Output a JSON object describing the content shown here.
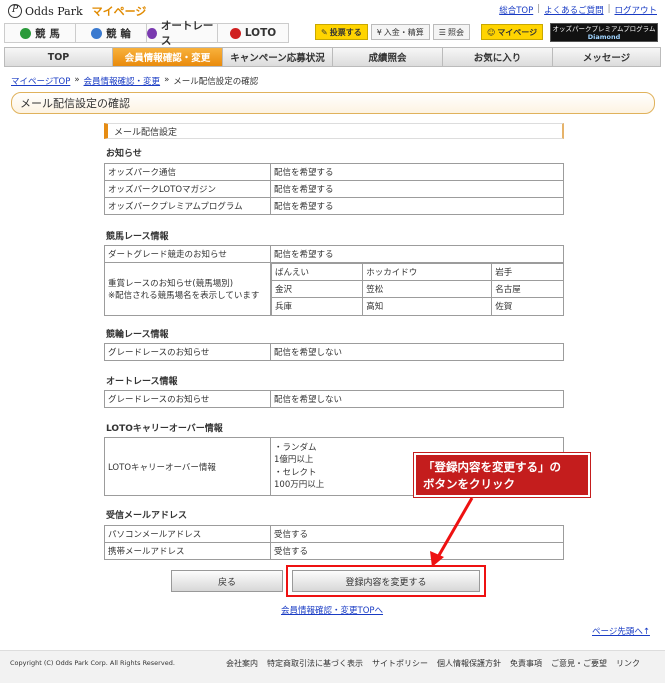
{
  "header": {
    "logo_text": "Odds Park",
    "logo_mypage": "マイページ",
    "top_links": [
      "総合TOP",
      "よくあるご質問",
      "ログアウト"
    ],
    "games": [
      {
        "label": "競 馬",
        "color": "#2a9a3a"
      },
      {
        "label": "競 輪",
        "color": "#3a7ad0"
      },
      {
        "label": "オートレース",
        "color": "#7a3ab0"
      },
      {
        "label": "LOTO",
        "color": "#d02020"
      }
    ],
    "actions": [
      "投票する",
      "入金・精算",
      "照会",
      "マイページ"
    ],
    "premium_line1": "オッズパークプレミアムプログラム",
    "premium_line2": "Diamond"
  },
  "nav": {
    "items": [
      "TOP",
      "会員情報確認・変更",
      "キャンペーン応募状況",
      "成績照会",
      "お気に入り",
      "メッセージ"
    ],
    "active": 1
  },
  "breadcrumb": {
    "items": [
      "マイページTOP",
      "会員情報確認・変更",
      "メール配信設定の確認"
    ],
    "sep": "»"
  },
  "page_title": "メール配信設定の確認",
  "section_title": "メール配信設定",
  "groups": {
    "notice": {
      "title": "お知らせ",
      "rows": [
        [
          "オッズパーク通信",
          "配信を希望する"
        ],
        [
          "オッズパークLOTOマガジン",
          "配信を希望する"
        ],
        [
          "オッズパークプレミアムプログラム",
          "配信を希望する"
        ]
      ]
    },
    "keiba": {
      "title": "競馬レース情報",
      "row1": [
        "ダートグレード競走のお知らせ",
        "配信を希望する"
      ],
      "row2_label1": "重賞レースのお知らせ(競馬場別)",
      "row2_label2": "※配信される競馬場名を表示しています",
      "venues": [
        [
          "ばんえい",
          "ホッカイドウ",
          "岩手"
        ],
        [
          "金沢",
          "笠松",
          "名古屋"
        ],
        [
          "兵庫",
          "高知",
          "佐賀"
        ]
      ]
    },
    "keirin": {
      "title": "競輪レース情報",
      "rows": [
        [
          "グレードレースのお知らせ",
          "配信を希望しない"
        ]
      ]
    },
    "auto": {
      "title": "オートレース情報",
      "rows": [
        [
          "グレードレースのお知らせ",
          "配信を希望しない"
        ]
      ]
    },
    "loto": {
      "title": "LOTOキャリーオーバー情報",
      "label": "LOTOキャリーオーバー情報",
      "lines": [
        "・ランダム",
        "1億円以上",
        "・セレクト",
        "100万円以上"
      ]
    },
    "mail": {
      "title": "受信メールアドレス",
      "rows": [
        [
          "パソコンメールアドレス",
          "受信する"
        ],
        [
          "携帯メールアドレス",
          "受信する"
        ]
      ]
    }
  },
  "buttons": {
    "back": "戻る",
    "change": "登録内容を変更する"
  },
  "callout": {
    "line1": "「登録内容を変更する」の",
    "line2": "ボタンをクリック"
  },
  "links": {
    "back_top": "会員情報確認・変更TOPへ",
    "page_top": "ページ先頭へ↑"
  },
  "footer": {
    "copyright": "Copyright (C) Odds Park Corp. All Rights Reserved.",
    "links": [
      "会社案内",
      "特定商取引法に基づく表示",
      "サイトポリシー",
      "個人情報保護方針",
      "免責事項",
      "ご意見・ご要望",
      "リンク"
    ]
  }
}
